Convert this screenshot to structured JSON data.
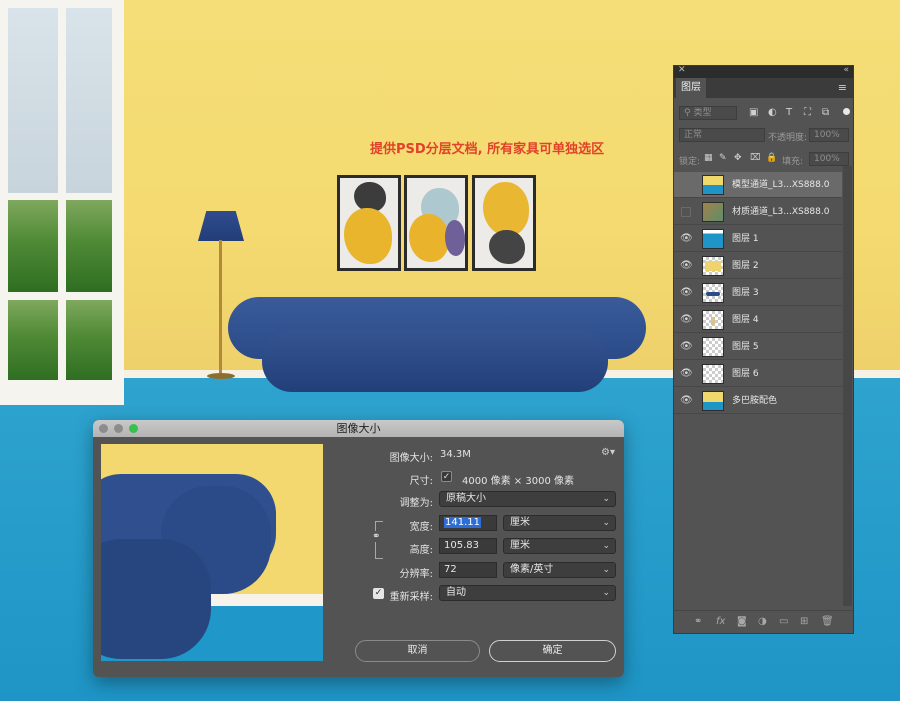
{
  "scene": {
    "headline": "提供PSD分层文档, 所有家具可单独选区"
  },
  "dialog": {
    "title": "图像大小",
    "image_size_label": "图像大小:",
    "image_size_value": "34.3M",
    "dimensions_label": "尺寸:",
    "dimensions_value": "4000 像素 × 3000 像素",
    "fit_to_label": "调整为:",
    "fit_to_value": "原稿大小",
    "width_label": "宽度:",
    "width_value": "141.11",
    "width_unit": "厘米",
    "height_label": "高度:",
    "height_value": "105.83",
    "height_unit": "厘米",
    "resolution_label": "分辨率:",
    "resolution_value": "72",
    "resolution_unit": "像素/英寸",
    "resample_label": "重新采样:",
    "resample_checked": true,
    "resample_value": "自动",
    "cancel_label": "取消",
    "ok_label": "确定"
  },
  "layers_panel": {
    "tab_label": "图层",
    "filter_placeholder": "类型",
    "blend_mode": "正常",
    "opacity_label": "不透明度:",
    "opacity_value": "100%",
    "lock_label": "锁定:",
    "fill_label": "填充:",
    "fill_value": "100%",
    "layers": [
      {
        "name": "模型通道_L3...XS888.0",
        "visible": false,
        "active": true
      },
      {
        "name": "材质通道_L3...XS888.0",
        "visible": false,
        "active": false
      },
      {
        "name": "图层 1",
        "visible": true,
        "active": false
      },
      {
        "name": "图层 2",
        "visible": true,
        "active": false
      },
      {
        "name": "图层 3",
        "visible": true,
        "active": false
      },
      {
        "name": "图层 4",
        "visible": true,
        "active": false
      },
      {
        "name": "图层 5",
        "visible": true,
        "active": false
      },
      {
        "name": "图层 6",
        "visible": true,
        "active": false
      },
      {
        "name": "多巴胺配色",
        "visible": true,
        "active": false
      }
    ]
  },
  "colors": {
    "wall": "#f4da70",
    "floor": "#1e95c6",
    "sofa": "#2a4a88",
    "headline": "#e2412a"
  }
}
